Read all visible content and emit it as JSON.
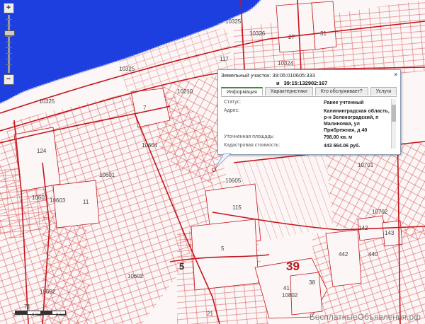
{
  "colors": {
    "sea": "#1d3fe0",
    "boundary": "#c3161c",
    "parcel_line": "#d24a4a",
    "background": "#fdf6f6",
    "popup_accent": "#3f8f30"
  },
  "zoom": {
    "plus": "+",
    "minus": "−"
  },
  "map_labels": {
    "l10325a": "10325",
    "l10325b": "10325",
    "l10325c": "10325",
    "l10326": "10326",
    "l10324": "10324",
    "l10210": "10210",
    "l10604": "10604",
    "l10601": "10601",
    "l10603": "10603",
    "l10605": "10605",
    "l10603b": "10603",
    "l10602": "10602",
    "l10602b": "10602",
    "l10701": "10701",
    "l10702": "10702",
    "l10802": "10802",
    "n27": "27",
    "n31": "31",
    "n117": "117",
    "n124": "124",
    "n7": "7",
    "n11": "11",
    "n115": "115",
    "n5": "5",
    "n5b": "5",
    "n39": "39",
    "n442": "442",
    "n440": "440",
    "n142": "142",
    "n143": "143",
    "n38": "38",
    "n21": "21",
    "n71": "71",
    "n41": "41"
  },
  "popup": {
    "title": "Земельный участок: 39:05:010605:333",
    "subtitle_and": "и",
    "subtitle_num": "39:15:132902:167",
    "close_icon": "×",
    "tabs": [
      "Информация",
      "Характеристики",
      "Кто обслуживает?",
      "Услуги"
    ],
    "rows": [
      {
        "label": "Статус:",
        "value": "Ранее учтенный"
      },
      {
        "label": "Адрес:",
        "value": "Калининградская область, р-н Зеленоградский, п Малиновка, ул Прибрежная, д 40"
      },
      {
        "label": "Уточненная площадь:",
        "value": "798.00 кв. м"
      },
      {
        "label": "Кадастровая стоимость:",
        "value": "443 664.06 руб."
      }
    ]
  },
  "scale": {
    "t0": "0",
    "t1": "0.3км",
    "t2": "0.6км"
  },
  "watermark": "БесплатныеОбъявления.рф"
}
